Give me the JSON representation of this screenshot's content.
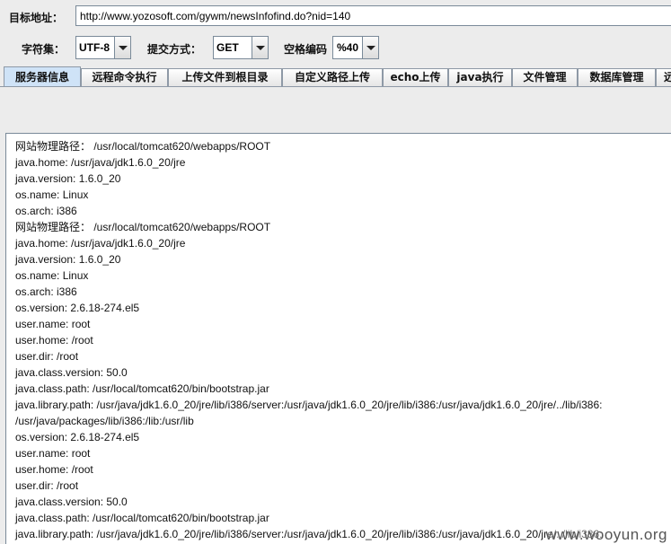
{
  "target": {
    "label": "目标地址：",
    "url": "http://www.yozosoft.com/gywm/newsInfofind.do?nid=140"
  },
  "options": {
    "charset_label": "字符集：",
    "charset_value": "UTF-8",
    "method_label": "提交方式：",
    "method_value": "GET",
    "space_label": "空格编码",
    "space_value": "%40"
  },
  "tabs": [
    {
      "label": "服务器信息",
      "active": true
    },
    {
      "label": "远程命令执行",
      "active": false
    },
    {
      "label": "上传文件到根目录",
      "active": false
    },
    {
      "label": "自定义路径上传",
      "active": false
    },
    {
      "label": "echo上传",
      "active": false
    },
    {
      "label": "java执行",
      "active": false
    },
    {
      "label": "文件管理",
      "active": false
    },
    {
      "label": "数据库管理",
      "active": false
    },
    {
      "label": "远",
      "active": false
    }
  ],
  "output_lines": [
    "网站物理路径： /usr/local/tomcat620/webapps/ROOT",
    "java.home: /usr/java/jdk1.6.0_20/jre",
    "java.version: 1.6.0_20",
    "os.name: Linux",
    "os.arch: i386",
    "网站物理路径： /usr/local/tomcat620/webapps/ROOT",
    "java.home: /usr/java/jdk1.6.0_20/jre",
    "java.version: 1.6.0_20",
    "os.name: Linux",
    "os.arch: i386",
    "os.version: 2.6.18-274.el5",
    "user.name: root",
    "user.home: /root",
    "user.dir: /root",
    "java.class.version: 50.0",
    "java.class.path: /usr/local/tomcat620/bin/bootstrap.jar",
    "java.library.path: /usr/java/jdk1.6.0_20/jre/lib/i386/server:/usr/java/jdk1.6.0_20/jre/lib/i386:/usr/java/jdk1.6.0_20/jre/../lib/i386:",
    "/usr/java/packages/lib/i386:/lib:/usr/lib",
    "os.version: 2.6.18-274.el5",
    "user.name: root",
    "user.home: /root",
    "user.dir: /root",
    "java.class.version: 50.0",
    "java.class.path: /usr/local/tomcat620/bin/bootstrap.jar",
    "java.library.path: /usr/java/jdk1.6.0_20/jre/lib/i386/server:/usr/java/jdk1.6.0_20/jre/lib/i386:/usr/java/jdk1.6.0_20/jre/../lib/i386:"
  ],
  "watermark": "www.wooyun.org"
}
